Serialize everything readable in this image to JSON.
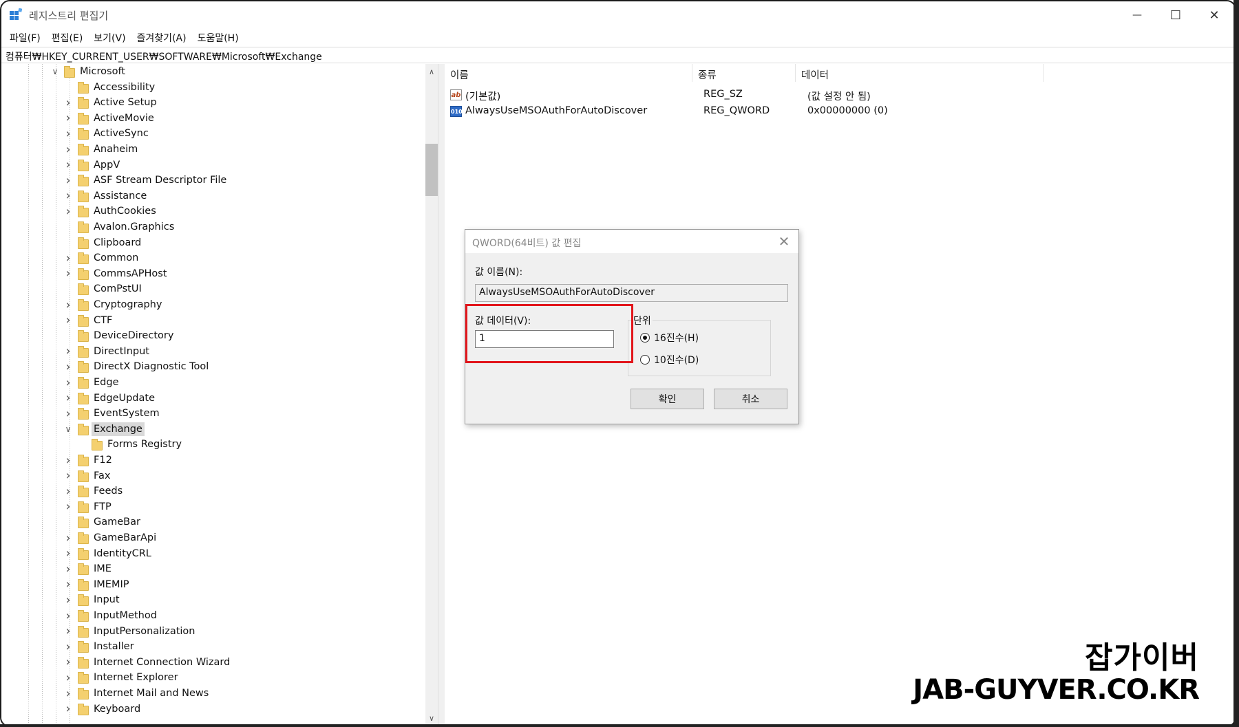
{
  "window": {
    "title": "레지스트리 편집기",
    "controls": {
      "minimize": "—",
      "maximize": "☐",
      "close": "✕"
    }
  },
  "menu": [
    "파일(F)",
    "편집(E)",
    "보기(V)",
    "즐겨찾기(A)",
    "도움말(H)"
  ],
  "address": "컴퓨터₩HKEY_CURRENT_USER₩SOFTWARE₩Microsoft₩Exchange",
  "tree": {
    "parent": "Microsoft",
    "items": [
      {
        "label": "Accessibility",
        "expandable": false
      },
      {
        "label": "Active Setup",
        "expandable": true
      },
      {
        "label": "ActiveMovie",
        "expandable": true
      },
      {
        "label": "ActiveSync",
        "expandable": true
      },
      {
        "label": "Anaheim",
        "expandable": true
      },
      {
        "label": "AppV",
        "expandable": true
      },
      {
        "label": "ASF Stream Descriptor File",
        "expandable": true
      },
      {
        "label": "Assistance",
        "expandable": true
      },
      {
        "label": "AuthCookies",
        "expandable": true
      },
      {
        "label": "Avalon.Graphics",
        "expandable": false
      },
      {
        "label": "Clipboard",
        "expandable": false
      },
      {
        "label": "Common",
        "expandable": true
      },
      {
        "label": "CommsAPHost",
        "expandable": true
      },
      {
        "label": "ComPstUI",
        "expandable": false
      },
      {
        "label": "Cryptography",
        "expandable": true
      },
      {
        "label": "CTF",
        "expandable": true
      },
      {
        "label": "DeviceDirectory",
        "expandable": false
      },
      {
        "label": "DirectInput",
        "expandable": true
      },
      {
        "label": "DirectX Diagnostic Tool",
        "expandable": true
      },
      {
        "label": "Edge",
        "expandable": true
      },
      {
        "label": "EdgeUpdate",
        "expandable": true
      },
      {
        "label": "EventSystem",
        "expandable": true
      },
      {
        "label": "Exchange",
        "expandable": true,
        "expanded": true,
        "selected": true
      },
      {
        "label": "Forms Registry",
        "expandable": false,
        "child": true
      },
      {
        "label": "F12",
        "expandable": true
      },
      {
        "label": "Fax",
        "expandable": true
      },
      {
        "label": "Feeds",
        "expandable": true
      },
      {
        "label": "FTP",
        "expandable": true
      },
      {
        "label": "GameBar",
        "expandable": false
      },
      {
        "label": "GameBarApi",
        "expandable": true
      },
      {
        "label": "IdentityCRL",
        "expandable": true
      },
      {
        "label": "IME",
        "expandable": true
      },
      {
        "label": "IMEMIP",
        "expandable": true
      },
      {
        "label": "Input",
        "expandable": true
      },
      {
        "label": "InputMethod",
        "expandable": true
      },
      {
        "label": "InputPersonalization",
        "expandable": true
      },
      {
        "label": "Installer",
        "expandable": true
      },
      {
        "label": "Internet Connection Wizard",
        "expandable": true
      },
      {
        "label": "Internet Explorer",
        "expandable": true
      },
      {
        "label": "Internet Mail and News",
        "expandable": true
      },
      {
        "label": "Keyboard",
        "expandable": true
      }
    ]
  },
  "list": {
    "columns": [
      "이름",
      "종류",
      "데이터"
    ],
    "rows": [
      {
        "icon": "string-value-icon",
        "icon_text": "ab",
        "name": "(기본값)",
        "type": "REG_SZ",
        "data": "(값 설정 안 됨)"
      },
      {
        "icon": "binary-value-icon",
        "icon_text": "010",
        "name": "AlwaysUseMSOAuthForAutoDiscover",
        "type": "REG_QWORD",
        "data": "0x00000000 (0)"
      }
    ]
  },
  "dialog": {
    "title": "QWORD(64비트) 값 편집",
    "close": "✕",
    "name_label": "값 이름(N):",
    "name_value": "AlwaysUseMSOAuthForAutoDiscover",
    "data_label": "값 데이터(V):",
    "data_value": "1",
    "base_label": "단위",
    "base_options": [
      {
        "label": "16진수(H)",
        "selected": true
      },
      {
        "label": "10진수(D)",
        "selected": false
      }
    ],
    "ok": "확인",
    "cancel": "취소"
  },
  "watermark": {
    "korean": "잡가이버",
    "site": "JAB-GUYVER.CO.KR"
  },
  "colors": {
    "highlight": "#e2151b",
    "folder": "#f4d06f",
    "selection": "#d9d9d9"
  }
}
